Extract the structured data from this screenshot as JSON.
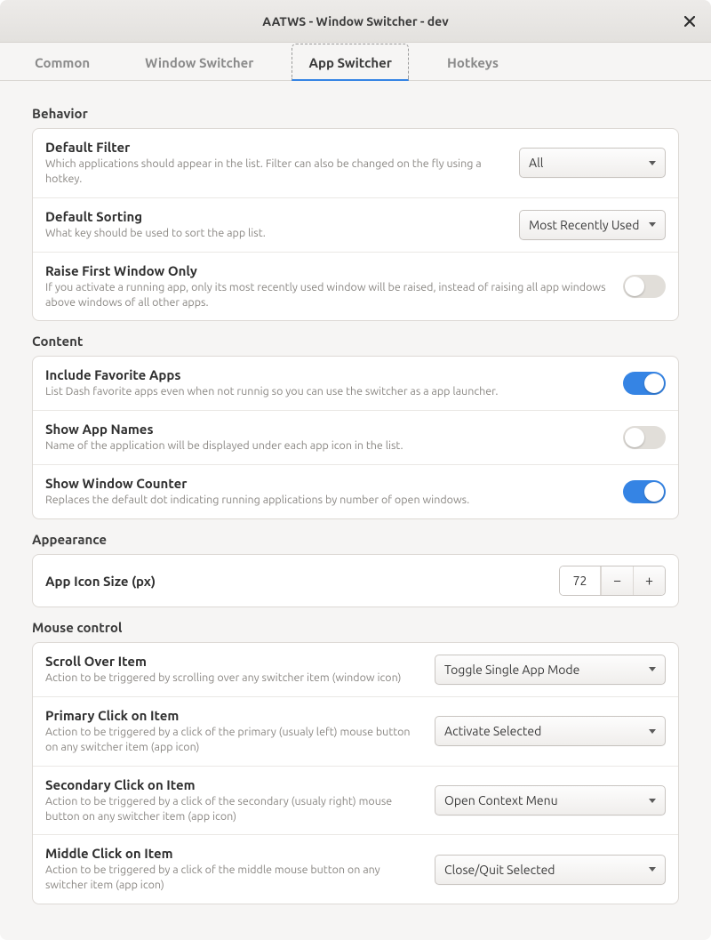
{
  "window": {
    "title": "AATWS - Window Switcher - dev"
  },
  "tabs": {
    "common": "Common",
    "window_switcher": "Window Switcher",
    "app_switcher": "App Switcher",
    "hotkeys": "Hotkeys"
  },
  "sections": {
    "behavior": {
      "label": "Behavior",
      "default_filter": {
        "title": "Default Filter",
        "desc": "Which applications should appear in the list. Filter can also be changed on the fly using a hotkey.",
        "value": "All"
      },
      "default_sorting": {
        "title": "Default Sorting",
        "desc": "What key should be used to sort the app list.",
        "value": "Most Recently Used"
      },
      "raise_first": {
        "title": "Raise First Window Only",
        "desc": "If you activate a running app, only its most recently used window will be raised, instead of raising all app windows above windows of all other apps.",
        "value": false
      }
    },
    "content": {
      "label": "Content",
      "include_favorites": {
        "title": "Include Favorite Apps",
        "desc": "List Dash favorite apps even when not runnig so you can use the switcher as a app launcher.",
        "value": true
      },
      "show_app_names": {
        "title": "Show App Names",
        "desc": "Name of the application will be displayed under each app icon in the list.",
        "value": false
      },
      "show_window_counter": {
        "title": "Show Window Counter",
        "desc": "Replaces the default dot indicating running applications by number of open windows.",
        "value": true
      }
    },
    "appearance": {
      "label": "Appearance",
      "icon_size": {
        "title": "App Icon Size (px)",
        "value": "72"
      }
    },
    "mouse": {
      "label": "Mouse control",
      "scroll": {
        "title": "Scroll Over Item",
        "desc": "Action to be triggered by scrolling over any switcher item (window icon)",
        "value": "Toggle Single App Mode"
      },
      "primary": {
        "title": "Primary Click on Item",
        "desc": "Action to be triggered by a click of the primary (usualy left) mouse button on any switcher item (app icon)",
        "value": "Activate Selected"
      },
      "secondary": {
        "title": "Secondary Click on Item",
        "desc": "Action to be triggered by a click of the secondary (usualy right) mouse button on any switcher item (app icon)",
        "value": "Open Context Menu"
      },
      "middle": {
        "title": "Middle Click on Item",
        "desc": "Action to be triggered by a click of the middle mouse button on any switcher item (app icon)",
        "value": "Close/Quit Selected"
      }
    }
  }
}
